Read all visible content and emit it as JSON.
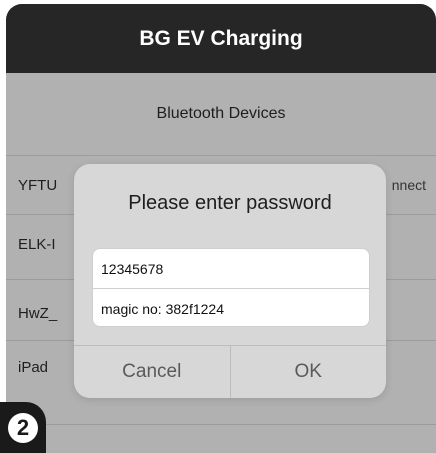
{
  "navbar": {
    "title": "BG EV Charging"
  },
  "section": {
    "header": "Bluetooth Devices"
  },
  "devices": [
    {
      "name": "YFTU",
      "action": "nnect"
    },
    {
      "name": "ELK-I"
    },
    {
      "name": "HwZ_"
    },
    {
      "name": "iPad"
    }
  ],
  "dialog": {
    "title": "Please enter password",
    "password_value": "12345678",
    "magic_value": "magic no: 382f1224",
    "cancel_label": "Cancel",
    "ok_label": "OK"
  },
  "step_badge": "2",
  "colors": {
    "navbar_bg": "#262626",
    "screen_bg": "#b1b1b1",
    "dialog_bg": "#d7d7d7"
  }
}
